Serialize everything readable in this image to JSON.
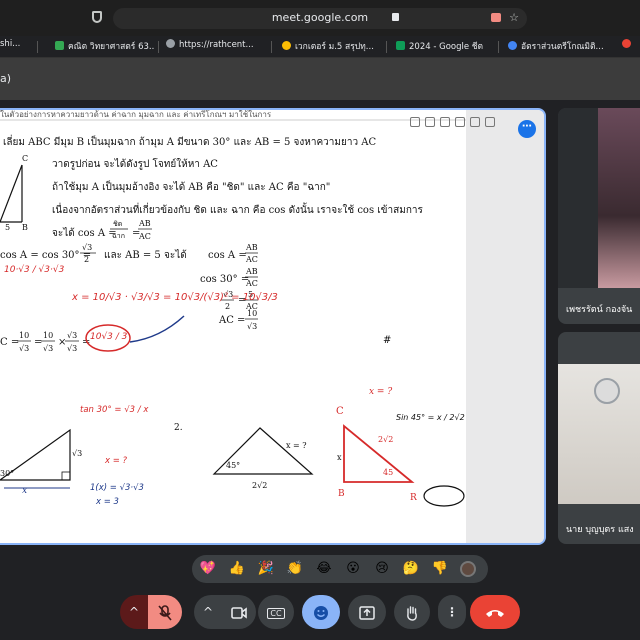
{
  "browser": {
    "url": "meet.google.com",
    "tabs": [
      {
        "label": "shi...",
        "color": "#888888"
      },
      {
        "label": "คณิต วิทยาศาสตร์ 63...",
        "color": "#34a853"
      },
      {
        "label": "https://rathcent...",
        "color": "#9aa0a6"
      },
      {
        "label": "เวกเตอร์ ม.5 สรุปทุ...",
        "color": "#fbbc04"
      },
      {
        "label": "2024 - Google ชีต",
        "color": "#0f9d58"
      },
      {
        "label": "อัตราส่วนตรีโกณมิติ...",
        "color": "#4285f4"
      }
    ]
  },
  "meet": {
    "title": "a)",
    "participants": [
      {
        "name": "เพชรรัตน์ กองจัน"
      },
      {
        "name": "นาย บุญบุตร แสง"
      }
    ]
  },
  "document": {
    "header_text": "ในตัวอย่างการหาความยาวด้าน ค่าฉาก มุมฉาก และ ค่าเทรีโกณฯ มาใช้ในการ",
    "line1": "เลี่ยม ABC มีมุม B เป็นมุมฉาก ถ้ามุม A มีขนาด 30° และ AB = 5  จงหาความยาว AC",
    "line2": "วาดรูปก่อน จะได้ดังรูป โจทย์ให้หา AC",
    "line3": "ถ้าใช้มุม A เป็นมุมอ้างอิง จะได้ AB คือ \"ชิด\" และ AC คือ \"ฉาก\"",
    "line4": "เนื่องจากอัตราส่วนที่เกี่ยวข้องกับ ชิด และ ฉาก คือ cos ดังนั้น เราจะใช้ cos เข้าสมการ",
    "line5": "จะได้ cos A = ",
    "frac_chit": "ชิด",
    "frac_chak": "ฉาก",
    "frac_ab": "AB",
    "frac_ac": "AC",
    "eq_cos": "cos A = cos 30° = ",
    "sqrt3_over_2": "√3",
    "two": "2",
    "and_ab": "และ   AB = 5  จะได้",
    "cosA": "cos A =",
    "cos30": "cos 30° =",
    "five": "5",
    "ten": "10",
    "sqrt3": "√3",
    "acres": "AC =",
    "final": "C = ",
    "times": "×",
    "hash": "#",
    "num2": "2.",
    "label_c_top": "C",
    "label_b": "B",
    "label_s": "5",
    "tri1_angle": "30°",
    "tri1_side": "√3",
    "tri1_x": "x",
    "tri2_angle": "45°",
    "tri2_side": "x = ?",
    "tri2_base": "2√2",
    "tri3_side": "2√2",
    "tri3_angle": "45",
    "tri3_x": "x",
    "tri3_c": "C",
    "tri3_b": "B",
    "tri3_r": "R",
    "hand_x_eq": "x = ?",
    "hand_sin45": "Sin 45° = x / 2√2",
    "hand_tan30": "tan 30° = √3 / x",
    "hand_x_q2": "x = ?",
    "hand_1x": "1(x) = √3·√3",
    "hand_x3": "x = 3",
    "hand_red1": "10·√3 / √3·√3",
    "hand_red2": "x = 10/√3 · √3/√3 = 10√3/(√3)² = 10√3/3",
    "hand_red3": "10√3 / 3"
  },
  "reactions": [
    "💖",
    "👍",
    "🎉",
    "👏",
    "😂",
    "😮",
    "😢",
    "🤔",
    "👎"
  ],
  "controls": {
    "chevron": "^",
    "cc": "CC"
  },
  "colors": {
    "accent": "#8ab4f8",
    "end_call": "#ea4335",
    "mic_off": "#f28b82",
    "active_emoji": "#8ab4f8",
    "red_ink": "#d62a2a",
    "navy_ink": "#1f3a8a"
  }
}
